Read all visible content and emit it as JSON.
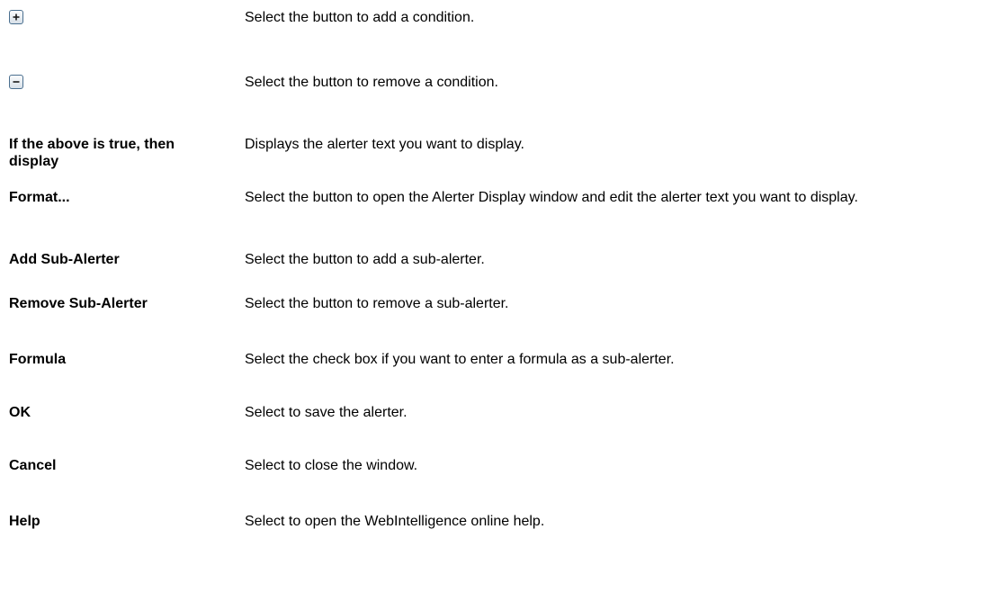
{
  "rows": [
    {
      "icon": "plus-icon",
      "term": "",
      "desc": "Select the button to add a condition."
    },
    {
      "icon": "minus-icon",
      "term": "",
      "desc": "Select the button to remove a condition."
    },
    {
      "icon": "",
      "term": "If the above is true, then display",
      "desc": "Displays the alerter text you want to display."
    },
    {
      "icon": "",
      "term": "Format...",
      "desc": "Select the button to open the Alerter Display window and edit the alerter text you want to display."
    },
    {
      "icon": "",
      "term": "Add Sub-Alerter",
      "desc": "Select the button to add a sub-alerter."
    },
    {
      "icon": "",
      "term": "Remove Sub-Alerter",
      "desc": "Select the button to remove a sub-alerter."
    },
    {
      "icon": "",
      "term": "Formula",
      "desc": "Select the check box if you want to enter a formula as a sub-alerter."
    },
    {
      "icon": "",
      "term": "OK",
      "desc": "Select to save the alerter."
    },
    {
      "icon": "",
      "term": "Cancel",
      "desc": "Select to close the window."
    },
    {
      "icon": "",
      "term": "Help",
      "desc": "Select to open the WebIntelligence online help."
    }
  ]
}
